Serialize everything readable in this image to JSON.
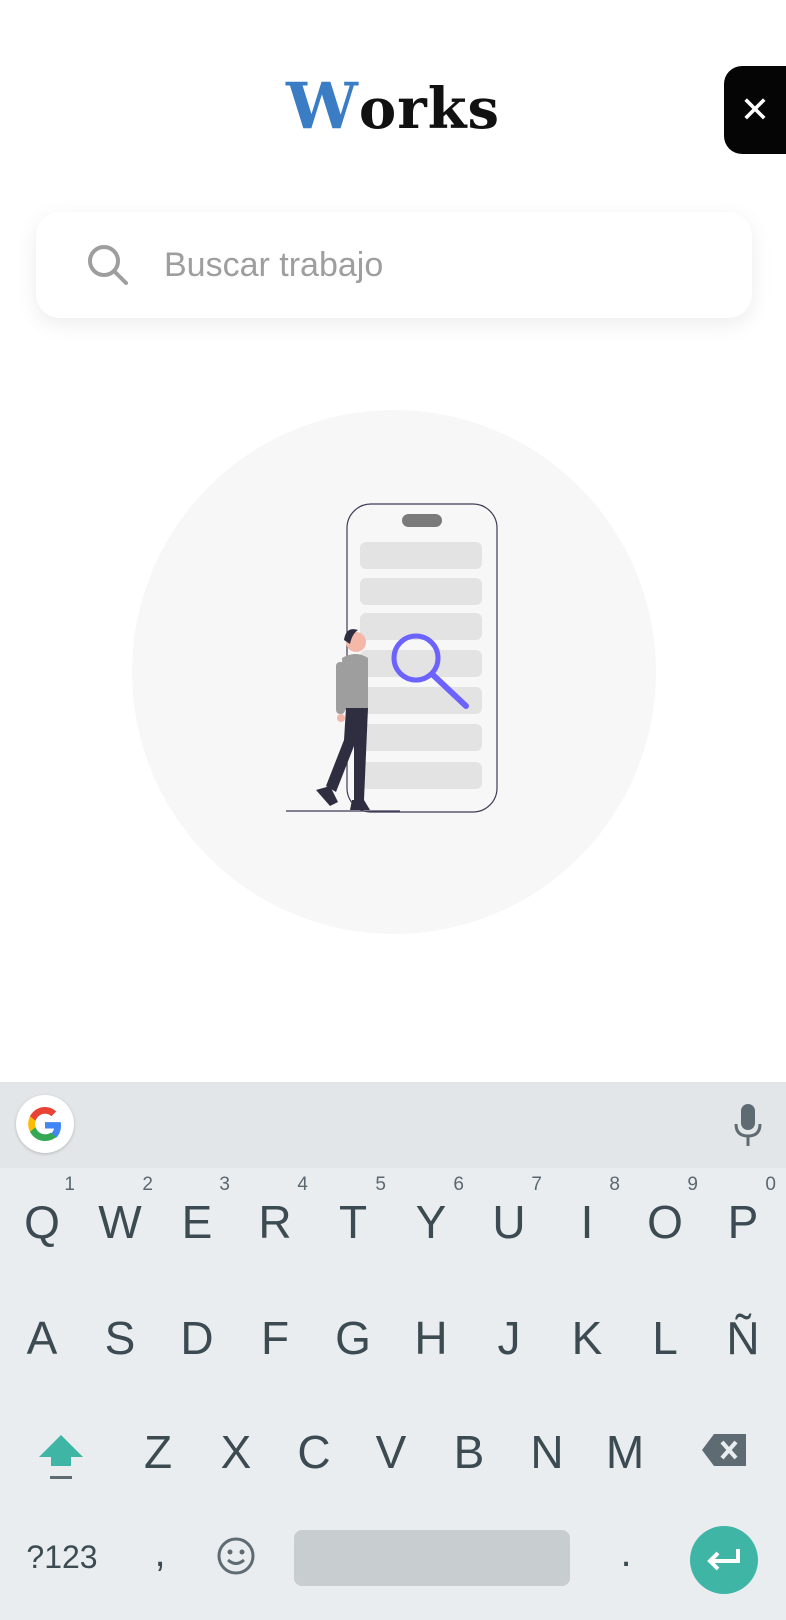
{
  "app": {
    "logo_first": "W",
    "logo_rest": "orks",
    "close_symbol": "✕"
  },
  "search": {
    "placeholder": "Buscar trabajo",
    "icon": "search-icon"
  },
  "illustration": {
    "icon": "person-searching-phone-illustration",
    "accent_color": "#6c63ff"
  },
  "keyboard": {
    "row1": [
      {
        "label": "Q",
        "hint": "1"
      },
      {
        "label": "W",
        "hint": "2"
      },
      {
        "label": "E",
        "hint": "3"
      },
      {
        "label": "R",
        "hint": "4"
      },
      {
        "label": "T",
        "hint": "5"
      },
      {
        "label": "Y",
        "hint": "6"
      },
      {
        "label": "U",
        "hint": "7"
      },
      {
        "label": "I",
        "hint": "8"
      },
      {
        "label": "O",
        "hint": "9"
      },
      {
        "label": "P",
        "hint": "0"
      }
    ],
    "row2": [
      "A",
      "S",
      "D",
      "F",
      "G",
      "H",
      "J",
      "K",
      "L",
      "Ñ"
    ],
    "row3": [
      "Z",
      "X",
      "C",
      "V",
      "B",
      "N",
      "M"
    ],
    "symbols_label": "?123",
    "comma_label": ",",
    "period_label": ".",
    "accent_color": "#3fb5a6"
  }
}
